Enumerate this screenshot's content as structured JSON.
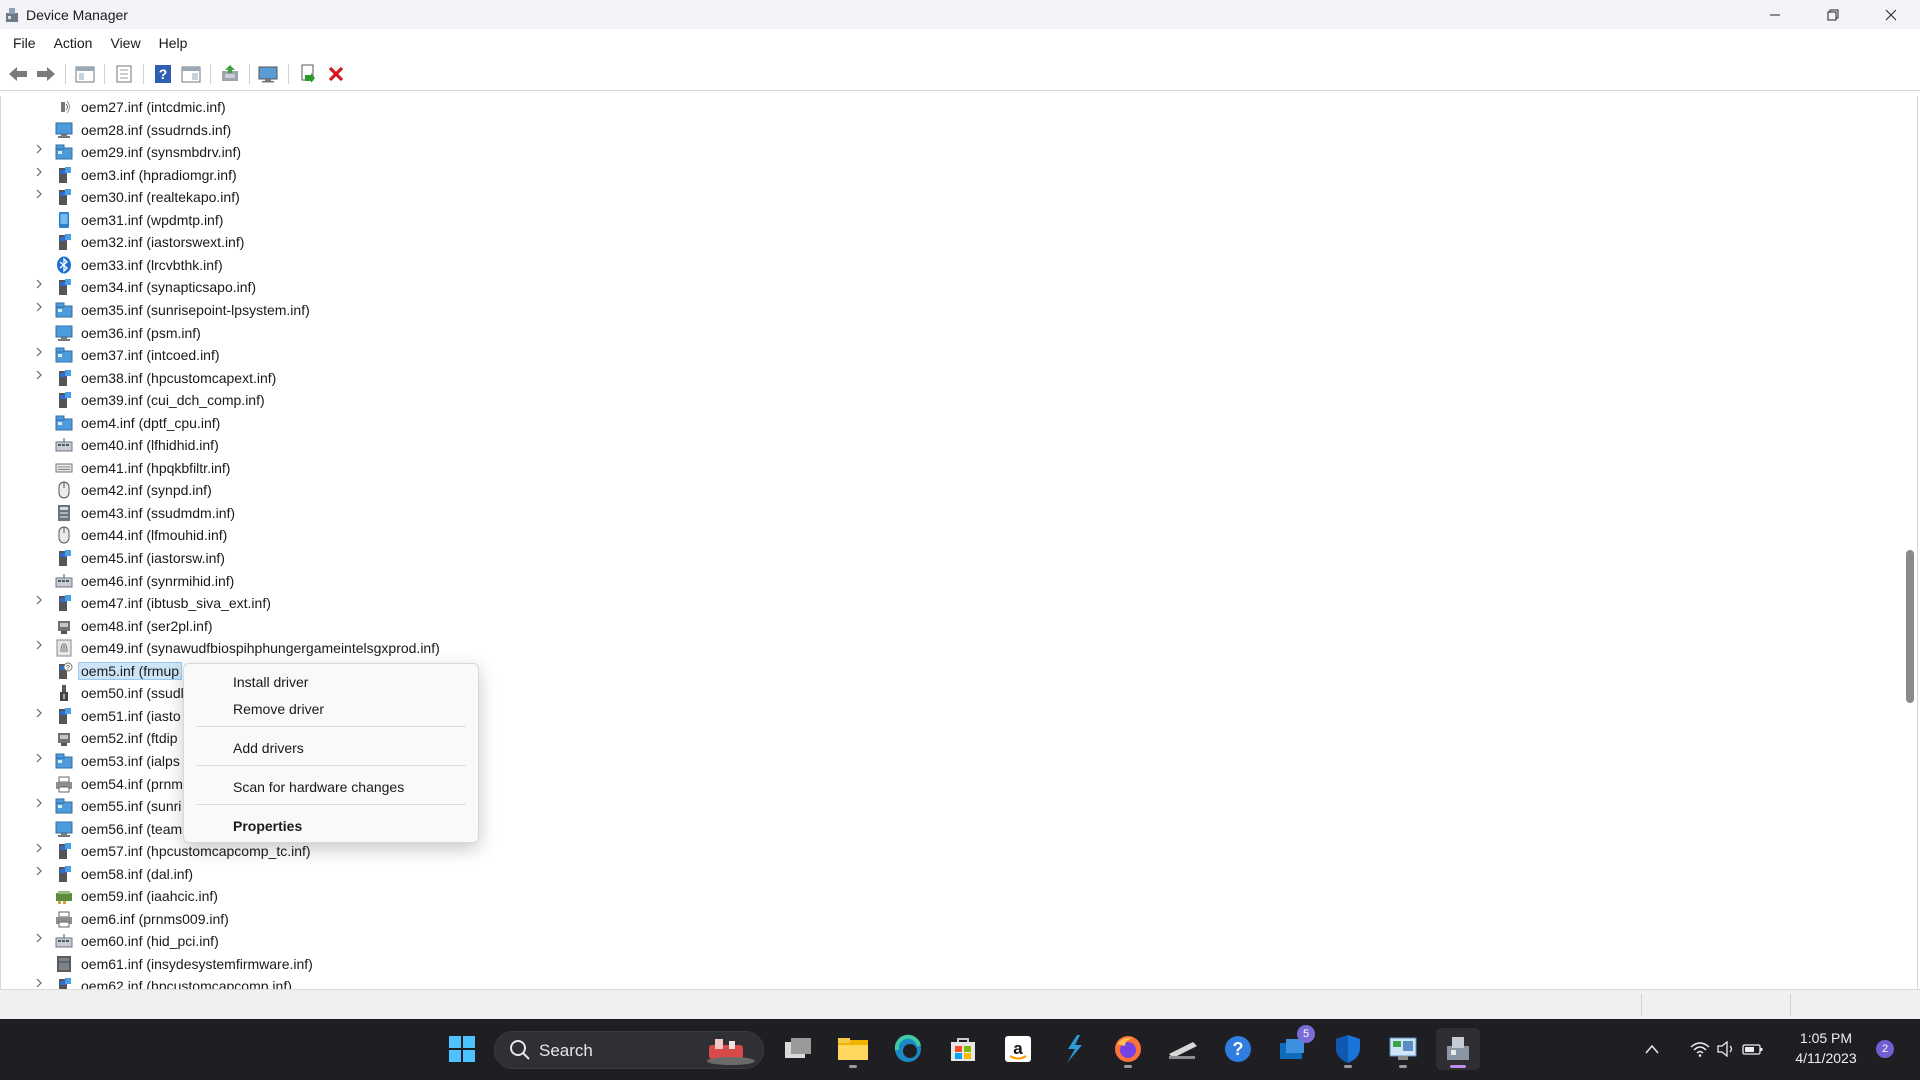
{
  "window": {
    "title": "Device Manager"
  },
  "menu": [
    "File",
    "Action",
    "View",
    "Help"
  ],
  "toolbar": {
    "buttons": [
      "back-arrow-icon",
      "forward-arrow-icon",
      "show-hide-tree-icon",
      "properties-page-icon",
      "help-icon",
      "action-pane-icon",
      "update-driver-icon",
      "monitor-icon",
      "install-driver-icon",
      "remove-device-icon"
    ],
    "remove_color": "#d4191c"
  },
  "tree": [
    {
      "label": "oem27.inf (intcdmic.inf)",
      "expandable": false,
      "icon": "audio-icon"
    },
    {
      "label": "oem28.inf (ssudrnds.inf)",
      "expandable": false,
      "icon": "network-icon"
    },
    {
      "label": "oem29.inf (synsmbdrv.inf)",
      "expandable": true,
      "icon": "system-device-icon"
    },
    {
      "label": "oem3.inf (hpradiomgr.inf)",
      "expandable": true,
      "icon": "chip-device-icon"
    },
    {
      "label": "oem30.inf (realtekapo.inf)",
      "expandable": true,
      "icon": "chip-device-icon"
    },
    {
      "label": "oem31.inf (wpdmtp.inf)",
      "expandable": false,
      "icon": "portable-device-icon"
    },
    {
      "label": "oem32.inf (iastorswext.inf)",
      "expandable": false,
      "icon": "chip-device-icon"
    },
    {
      "label": "oem33.inf (lrcvbthk.inf)",
      "expandable": false,
      "icon": "bluetooth-icon"
    },
    {
      "label": "oem34.inf (synapticsapo.inf)",
      "expandable": true,
      "icon": "chip-device-icon"
    },
    {
      "label": "oem35.inf (sunrisepoint-lpsystem.inf)",
      "expandable": true,
      "icon": "system-device-icon"
    },
    {
      "label": "oem36.inf (psm.inf)",
      "expandable": false,
      "icon": "network-icon"
    },
    {
      "label": "oem37.inf (intcoed.inf)",
      "expandable": true,
      "icon": "system-device-icon"
    },
    {
      "label": "oem38.inf (hpcustomcapext.inf)",
      "expandable": true,
      "icon": "chip-device-icon"
    },
    {
      "label": "oem39.inf (cui_dch_comp.inf)",
      "expandable": false,
      "icon": "chip-device-icon"
    },
    {
      "label": "oem4.inf (dptf_cpu.inf)",
      "expandable": false,
      "icon": "system-device-icon"
    },
    {
      "label": "oem40.inf (lfhidhid.inf)",
      "expandable": false,
      "icon": "hid-icon"
    },
    {
      "label": "oem41.inf (hpqkbfiltr.inf)",
      "expandable": false,
      "icon": "keyboard-icon"
    },
    {
      "label": "oem42.inf (synpd.inf)",
      "expandable": false,
      "icon": "mouse-icon"
    },
    {
      "label": "oem43.inf (ssudmdm.inf)",
      "expandable": false,
      "icon": "modem-icon"
    },
    {
      "label": "oem44.inf (lfmouhid.inf)",
      "expandable": false,
      "icon": "mouse-icon"
    },
    {
      "label": "oem45.inf (iastorsw.inf)",
      "expandable": false,
      "icon": "chip-device-icon"
    },
    {
      "label": "oem46.inf (synrmihid.inf)",
      "expandable": false,
      "icon": "hid-icon"
    },
    {
      "label": "oem47.inf (ibtusb_siva_ext.inf)",
      "expandable": true,
      "icon": "chip-device-icon"
    },
    {
      "label": "oem48.inf (ser2pl.inf)",
      "expandable": false,
      "icon": "port-icon"
    },
    {
      "label": "oem49.inf (synawudfbiospihphungergameintelsgxprod.inf)",
      "expandable": true,
      "icon": "fingerprint-icon"
    },
    {
      "label": "oem5.inf (frmup",
      "expandable": false,
      "icon": "unknown-device-icon",
      "selected": true
    },
    {
      "label": "oem50.inf (ssudl",
      "expandable": false,
      "icon": "usb-icon"
    },
    {
      "label": "oem51.inf (iasto",
      "expandable": true,
      "icon": "chip-device-icon"
    },
    {
      "label": "oem52.inf (ftdip",
      "expandable": false,
      "icon": "port-icon"
    },
    {
      "label": "oem53.inf (ialps",
      "expandable": true,
      "icon": "system-device-icon"
    },
    {
      "label": "oem54.inf (prnm",
      "expandable": false,
      "icon": "printer-icon"
    },
    {
      "label": "oem55.inf (sunri",
      "expandable": true,
      "icon": "system-device-icon"
    },
    {
      "label": "oem56.inf (team",
      "expandable": false,
      "icon": "network-icon"
    },
    {
      "label": "oem57.inf (hpcustomcapcomp_tc.inf)",
      "expandable": true,
      "icon": "chip-device-icon"
    },
    {
      "label": "oem58.inf (dal.inf)",
      "expandable": true,
      "icon": "chip-device-icon"
    },
    {
      "label": "oem59.inf (iaahcic.inf)",
      "expandable": false,
      "icon": "storage-controller-icon"
    },
    {
      "label": "oem6.inf (prnms009.inf)",
      "expandable": false,
      "icon": "printer-icon"
    },
    {
      "label": "oem60.inf (hid_pci.inf)",
      "expandable": true,
      "icon": "hid-icon"
    },
    {
      "label": "oem61.inf (insydesystemfirmware.inf)",
      "expandable": false,
      "icon": "firmware-icon"
    },
    {
      "label": "oem62.inf (hpcustomcapcomp.inf)",
      "expandable": true,
      "icon": "chip-device-icon"
    }
  ],
  "context_menu": {
    "install": "Install driver",
    "remove": "Remove driver",
    "add": "Add drivers",
    "scan": "Scan for hardware changes",
    "properties": "Properties"
  },
  "taskbar": {
    "search_label": "Search",
    "apps": [
      "start-icon",
      "task-view-icon",
      "file-explorer-icon",
      "edge-icon",
      "store-icon",
      "amazon-icon",
      "visual-studio-icon",
      "firefox-icon",
      "surface-icon",
      "help-app-icon",
      "mail-icon",
      "defender-icon",
      "control-panel-icon",
      "device-manager-icon"
    ],
    "mail_badge": "5",
    "time": "1:05 PM",
    "date": "4/11/2023",
    "notification_count": "2"
  }
}
